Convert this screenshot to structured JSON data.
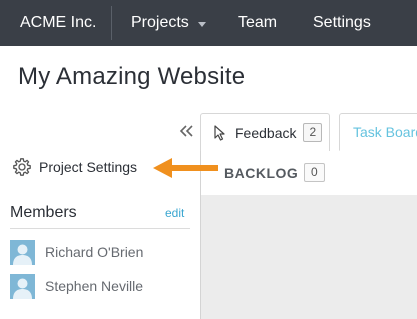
{
  "nav": {
    "brand": "ACME Inc.",
    "projects": "Projects",
    "team": "Team",
    "settings": "Settings"
  },
  "page": {
    "title": "My Amazing Website"
  },
  "sidebar": {
    "collapse_icon": "double-chevron-left-icon",
    "project_settings": "Project Settings",
    "members_title": "Members",
    "edit_label": "edit",
    "members": [
      {
        "name": "Richard O'Brien"
      },
      {
        "name": "Stephen Neville"
      }
    ]
  },
  "tabs": [
    {
      "label": "Feedback",
      "count": "2"
    },
    {
      "label": "Task Board"
    }
  ],
  "board": {
    "column_label": "BACKLOG",
    "column_count": "0"
  },
  "colors": {
    "nav_bg": "#3a3f47",
    "accent": "#3aa6d0",
    "arrow": "#f0901e",
    "board_bg": "#ececec"
  }
}
